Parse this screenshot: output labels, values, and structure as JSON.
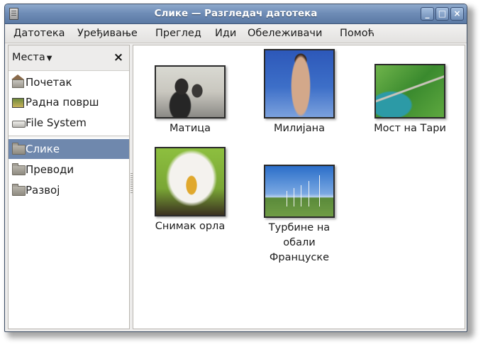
{
  "window": {
    "title": "Слике — Разгледач датотека",
    "controls": {
      "minimize": "_",
      "maximize": "□",
      "close": "×"
    }
  },
  "menubar": {
    "items": [
      "Датотека",
      "Уређивање",
      "Преглед",
      "Иди",
      "Обележивачи",
      "Помоћ"
    ]
  },
  "sidebar": {
    "selector_label": "Места",
    "close_glyph": "×",
    "places": [
      {
        "label": "Почетак",
        "icon": "home-folder-icon",
        "selected": false
      },
      {
        "label": "Радна површ",
        "icon": "desktop-icon",
        "selected": false
      },
      {
        "label": "File System",
        "icon": "drive-icon",
        "selected": false
      }
    ],
    "bookmarks": [
      {
        "label": "Слике",
        "icon": "folder-icon",
        "selected": true
      },
      {
        "label": "Преводи",
        "icon": "folder-icon",
        "selected": false
      },
      {
        "label": "Развој",
        "icon": "folder-icon",
        "selected": false
      }
    ]
  },
  "files": [
    {
      "label": "Матица",
      "thumbnail": "office-photo"
    },
    {
      "label": "Милијана",
      "thumbnail": "beach-photo"
    },
    {
      "label": "Мост на Тари",
      "thumbnail": "bridge-photo"
    },
    {
      "label": "Снимак орла",
      "thumbnail": "eagle-photo"
    },
    {
      "label": "Турбине на обали Француске",
      "thumbnail": "wind-turbines-photo"
    }
  ],
  "colors": {
    "titlebar": "#6f8db7",
    "selection": "#6f88ad",
    "window_bg": "#edeceb"
  }
}
